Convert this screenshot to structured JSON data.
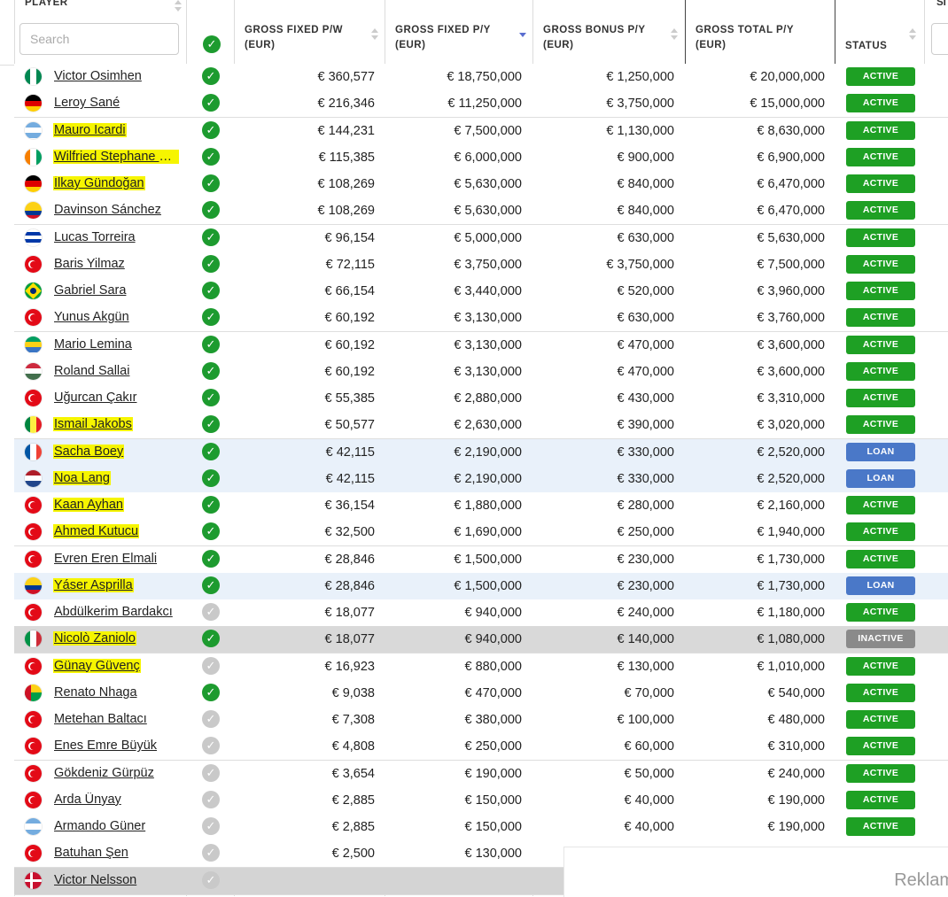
{
  "header": {
    "player": "PLAYER",
    "search_placeholder": "Search",
    "gross_fixed_pw": "GROSS FIXED P/W\n(EUR)",
    "gross_fixed_py": "GROSS FIXED P/Y\n(EUR)",
    "gross_bonus_py": "GROSS BONUS P/Y\n(EUR)",
    "gross_total_py": "GROSS TOTAL P/Y\n(EUR)",
    "status": "STATUS",
    "next_col": "SI"
  },
  "colors": {
    "active": "#1ea024",
    "loan": "#4a78c8",
    "inactive": "#8a8a8a",
    "highlight": "#f6f500",
    "check_on": "#1d9b2f",
    "check_off": "#c9c9c9"
  },
  "rows": [
    {
      "name": "Victor Osimhen",
      "flag": "nigeria",
      "hl": false,
      "check": true,
      "pw": "€ 360,577",
      "py": "€ 18,750,000",
      "bonus": "€ 1,250,000",
      "total": "€ 20,000,000",
      "status": "ACTIVE"
    },
    {
      "name": "Leroy Sané",
      "flag": "germany",
      "hl": false,
      "check": true,
      "pw": "€ 216,346",
      "py": "€ 11,250,000",
      "bonus": "€ 3,750,000",
      "total": "€ 15,000,000",
      "status": "ACTIVE"
    },
    {
      "name": "Mauro Icardi",
      "flag": "argentina",
      "hl": true,
      "check": true,
      "pw": "€ 144,231",
      "py": "€ 7,500,000",
      "bonus": "€ 1,130,000",
      "total": "€ 8,630,000",
      "status": "ACTIVE"
    },
    {
      "name": "Wilfried Stephane S...",
      "flag": "ivorycoast",
      "hl": true,
      "check": true,
      "pw": "€ 115,385",
      "py": "€ 6,000,000",
      "bonus": "€ 900,000",
      "total": "€ 6,900,000",
      "status": "ACTIVE"
    },
    {
      "name": "İlkay Gündoğan",
      "flag": "germany",
      "hl": true,
      "check": true,
      "pw": "€ 108,269",
      "py": "€ 5,630,000",
      "bonus": "€ 840,000",
      "total": "€ 6,470,000",
      "status": "ACTIVE"
    },
    {
      "name": "Davinson Sánchez",
      "flag": "colombia",
      "hl": false,
      "check": true,
      "pw": "€ 108,269",
      "py": "€ 5,630,000",
      "bonus": "€ 840,000",
      "total": "€ 6,470,000",
      "status": "ACTIVE"
    },
    {
      "name": "Lucas Torreira",
      "flag": "uruguay",
      "hl": false,
      "check": true,
      "pw": "€ 96,154",
      "py": "€ 5,000,000",
      "bonus": "€ 630,000",
      "total": "€ 5,630,000",
      "status": "ACTIVE"
    },
    {
      "name": "Baris Yilmaz",
      "flag": "turkey",
      "hl": false,
      "check": true,
      "pw": "€ 72,115",
      "py": "€ 3,750,000",
      "bonus": "€ 3,750,000",
      "total": "€ 7,500,000",
      "status": "ACTIVE"
    },
    {
      "name": "Gabriel Sara",
      "flag": "brazil",
      "hl": false,
      "check": true,
      "pw": "€ 66,154",
      "py": "€ 3,440,000",
      "bonus": "€ 520,000",
      "total": "€ 3,960,000",
      "status": "ACTIVE"
    },
    {
      "name": "Yunus Akgün",
      "flag": "turkey",
      "hl": false,
      "check": true,
      "pw": "€ 60,192",
      "py": "€ 3,130,000",
      "bonus": "€ 630,000",
      "total": "€ 3,760,000",
      "status": "ACTIVE"
    },
    {
      "name": "Mario Lemina",
      "flag": "gabon",
      "hl": false,
      "check": true,
      "pw": "€ 60,192",
      "py": "€ 3,130,000",
      "bonus": "€ 470,000",
      "total": "€ 3,600,000",
      "status": "ACTIVE"
    },
    {
      "name": "Roland Sallai",
      "flag": "hungary",
      "hl": false,
      "check": true,
      "pw": "€ 60,192",
      "py": "€ 3,130,000",
      "bonus": "€ 470,000",
      "total": "€ 3,600,000",
      "status": "ACTIVE"
    },
    {
      "name": "Uğurcan Çakır",
      "flag": "turkey",
      "hl": false,
      "check": true,
      "pw": "€ 55,385",
      "py": "€ 2,880,000",
      "bonus": "€ 430,000",
      "total": "€ 3,310,000",
      "status": "ACTIVE"
    },
    {
      "name": "Ismail Jakobs",
      "flag": "senegal",
      "hl": true,
      "check": true,
      "pw": "€ 50,577",
      "py": "€ 2,630,000",
      "bonus": "€ 390,000",
      "total": "€ 3,020,000",
      "status": "ACTIVE"
    },
    {
      "name": "Sacha Boey",
      "flag": "france",
      "hl": true,
      "check": true,
      "pw": "€ 42,115",
      "py": "€ 2,190,000",
      "bonus": "€ 330,000",
      "total": "€ 2,520,000",
      "status": "LOAN"
    },
    {
      "name": "Noa Lang",
      "flag": "netherlands",
      "hl": true,
      "check": true,
      "pw": "€ 42,115",
      "py": "€ 2,190,000",
      "bonus": "€ 330,000",
      "total": "€ 2,520,000",
      "status": "LOAN"
    },
    {
      "name": "Kaan Ayhan",
      "flag": "turkey",
      "hl": true,
      "check": true,
      "pw": "€ 36,154",
      "py": "€ 1,880,000",
      "bonus": "€ 280,000",
      "total": "€ 2,160,000",
      "status": "ACTIVE"
    },
    {
      "name": "Ahmed Kutucu",
      "flag": "turkey",
      "hl": true,
      "check": true,
      "pw": "€ 32,500",
      "py": "€ 1,690,000",
      "bonus": "€ 250,000",
      "total": "€ 1,940,000",
      "status": "ACTIVE"
    },
    {
      "name": "Evren Eren Elmali",
      "flag": "turkey",
      "hl": false,
      "check": true,
      "pw": "€ 28,846",
      "py": "€ 1,500,000",
      "bonus": "€ 230,000",
      "total": "€ 1,730,000",
      "status": "ACTIVE"
    },
    {
      "name": "Yáser Asprilla",
      "flag": "colombia",
      "hl": true,
      "check": true,
      "pw": "€ 28,846",
      "py": "€ 1,500,000",
      "bonus": "€ 230,000",
      "total": "€ 1,730,000",
      "status": "LOAN"
    },
    {
      "name": "Abdülkerim Bardakcı",
      "flag": "turkey",
      "hl": false,
      "check": false,
      "pw": "€ 18,077",
      "py": "€ 940,000",
      "bonus": "€ 240,000",
      "total": "€ 1,180,000",
      "status": "ACTIVE"
    },
    {
      "name": "Nicolò Zaniolo",
      "flag": "italy",
      "hl": true,
      "check": true,
      "pw": "€ 18,077",
      "py": "€ 940,000",
      "bonus": "€ 140,000",
      "total": "€ 1,080,000",
      "status": "INACTIVE"
    },
    {
      "name": "Günay Güvenç",
      "flag": "turkey",
      "hl": true,
      "check": false,
      "pw": "€ 16,923",
      "py": "€ 880,000",
      "bonus": "€ 130,000",
      "total": "€ 1,010,000",
      "status": "ACTIVE"
    },
    {
      "name": "Renato Nhaga",
      "flag": "guineabissau",
      "hl": false,
      "check": true,
      "pw": "€ 9,038",
      "py": "€ 470,000",
      "bonus": "€ 70,000",
      "total": "€ 540,000",
      "status": "ACTIVE"
    },
    {
      "name": "Metehan Baltacı",
      "flag": "turkey",
      "hl": false,
      "check": false,
      "pw": "€ 7,308",
      "py": "€ 380,000",
      "bonus": "€ 100,000",
      "total": "€ 480,000",
      "status": "ACTIVE"
    },
    {
      "name": "Enes Emre Büyük",
      "flag": "turkey",
      "hl": false,
      "check": false,
      "pw": "€ 4,808",
      "py": "€ 250,000",
      "bonus": "€ 60,000",
      "total": "€ 310,000",
      "status": "ACTIVE"
    },
    {
      "name": "Gökdeniz Gürpüz",
      "flag": "turkey",
      "hl": false,
      "check": false,
      "pw": "€ 3,654",
      "py": "€ 190,000",
      "bonus": "€ 50,000",
      "total": "€ 240,000",
      "status": "ACTIVE"
    },
    {
      "name": "Arda Ünyay",
      "flag": "turkey",
      "hl": false,
      "check": false,
      "pw": "€ 2,885",
      "py": "€ 150,000",
      "bonus": "€ 40,000",
      "total": "€ 190,000",
      "status": "ACTIVE"
    },
    {
      "name": "Armando Güner",
      "flag": "argentina",
      "hl": false,
      "check": false,
      "pw": "€ 2,885",
      "py": "€ 150,000",
      "bonus": "€ 40,000",
      "total": "€ 190,000",
      "status": "ACTIVE"
    },
    {
      "name": "Batuhan Şen",
      "flag": "turkey",
      "hl": false,
      "check": false,
      "pw": "€ 2,500",
      "py": "€ 130,000",
      "bonus": "",
      "total": "",
      "status": ""
    },
    {
      "name": "Victor Nelsson",
      "flag": "denmark",
      "hl": false,
      "check": false,
      "pw": "",
      "py": "",
      "bonus": "",
      "total": "",
      "status": ""
    }
  ],
  "ad_text": "Reklam"
}
